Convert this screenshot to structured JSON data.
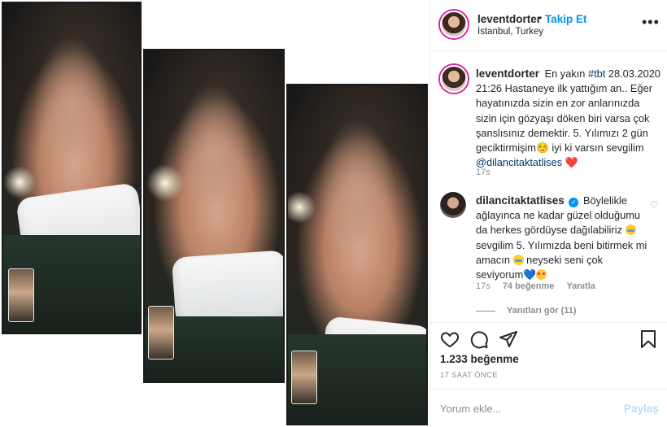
{
  "post": {
    "author": "leventdorter",
    "follow_label": "Takip Et",
    "location": "İstanbul, Turkey",
    "more_icon": "more-horizontal-icon",
    "caption": {
      "username": "leventdorter",
      "text_1": "En yakın",
      "hashtag": "#tbt",
      "text_2": "28.03.2020 21:26 Hastaneye ilk yattığım an.. Eğer hayatınızda sizin en zor anlarınızda sizin için gözyaşı döken biri varsa çok şanslısınız demektir. 5. Yılımızı 2 gün geciktirmişim☺️ iyi ki varsın sevgilim",
      "mention": "@dilancitaktatlises",
      "emoji": "❤️",
      "time": "17s"
    },
    "comment": {
      "username": "dilancitaktatlises",
      "text_1": "Böylelikle ağlayınca ne kadar güzel olduğumu da herkes gördüyse dağılabiliriz",
      "text_2": "sevgilim 5. Yılımızda beni bitirmek mi amacın",
      "text_3": "neyseki seni çok seviyorum",
      "blue_heart": "💙",
      "time": "17s",
      "likes": "74 beğenme",
      "reply": "Yanıtla",
      "view_replies": "Yanıtları gör (11)"
    },
    "likes_total": "1.233 beğenme",
    "time_ago": "17 SAAT ÖNCE",
    "add_comment_placeholder": "Yorum ekle...",
    "share_label": "Paylaş"
  },
  "colors": {
    "link_blue": "#0095f6",
    "tag_blue": "#00376b",
    "muted": "#8e8e8e",
    "share_disabled": "#b2dffc"
  }
}
